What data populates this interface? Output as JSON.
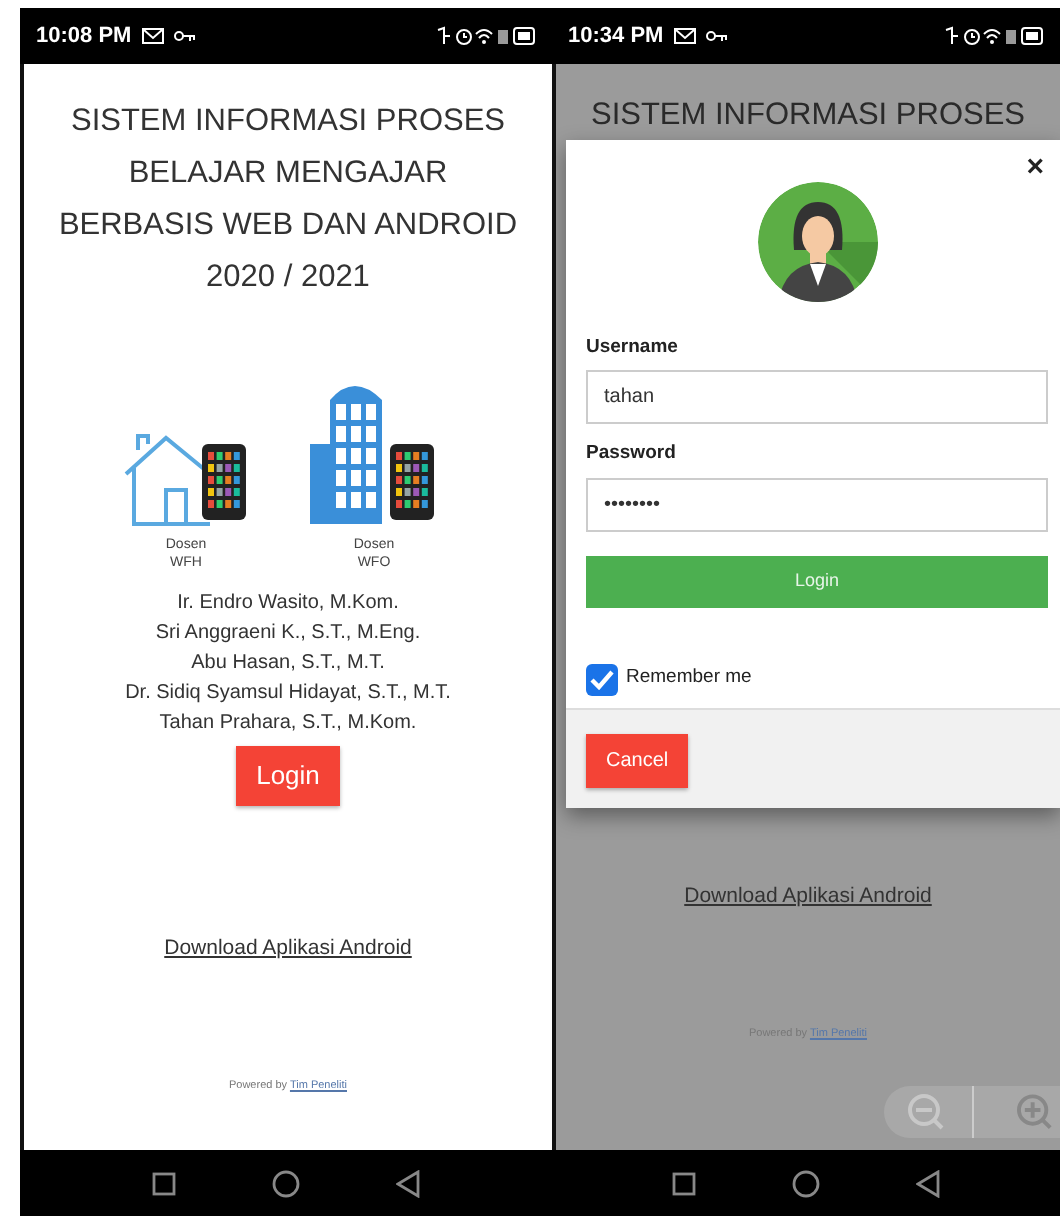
{
  "screens": [
    {
      "kind": "home",
      "status_bar": {
        "time": "10:08 PM"
      },
      "title_lines": [
        "SISTEM INFORMASI PROSES",
        "BELAJAR MENGAJAR",
        "BERBASIS WEB DAN ANDROID",
        "2020 / 2021"
      ],
      "illustrations": [
        {
          "kind": "house",
          "caption": "Dosen WFH"
        },
        {
          "kind": "building",
          "caption": "Dosen WFO"
        }
      ],
      "authors": [
        "Ir. Endro Wasito, M.Kom.",
        "Sri Anggraeni K., S.T., M.Eng.",
        "Abu Hasan, S.T., M.T.",
        "Dr. Sidiq Syamsul Hidayat, S.T., M.T.",
        "Tahan Prahara, S.T., M.Kom."
      ],
      "login_button": "Login",
      "download_link": "Download Aplikasi Android",
      "footer": {
        "prefix": "Powered by",
        "link": "Tim Peneliti"
      }
    },
    {
      "kind": "login_modal",
      "status_bar": {
        "time": "10:34 PM"
      },
      "title_lines": [
        "SISTEM INFORMASI PROSES"
      ],
      "modal": {
        "close": "×",
        "fields": [
          {
            "label": "Username",
            "value": "tahan"
          },
          {
            "label": "Password",
            "value": "••••••••"
          }
        ],
        "login_button": "Login",
        "remember": {
          "label": "Remember me",
          "checked": true
        },
        "cancel_button": "Cancel"
      },
      "download_link": "Download Aplikasi Android",
      "footer": {
        "prefix": "Powered by",
        "link": "Tim Peneliti"
      }
    }
  ]
}
